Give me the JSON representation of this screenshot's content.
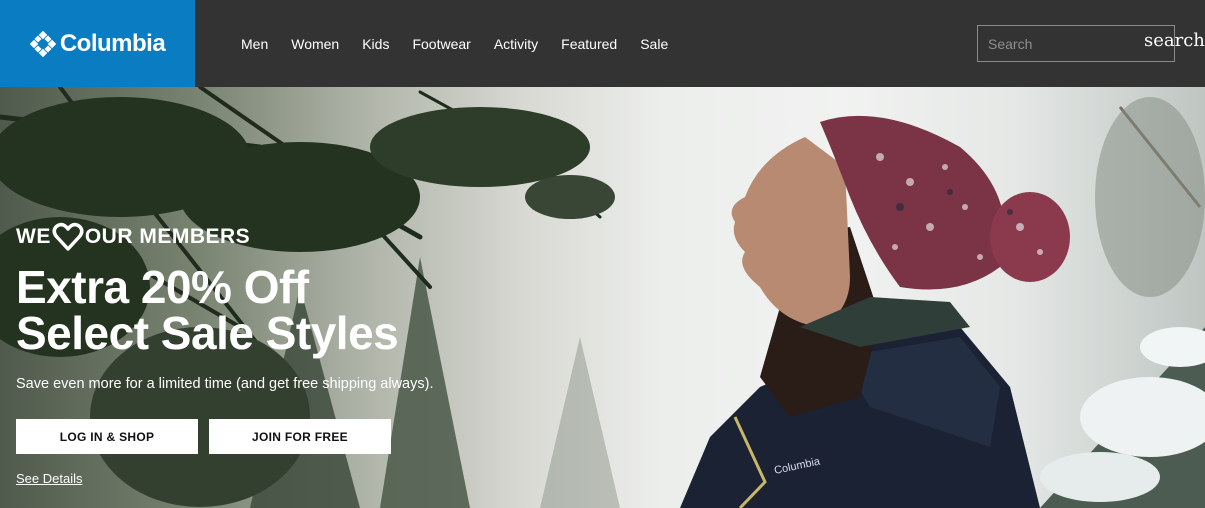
{
  "header": {
    "logo_text": "Columbia",
    "nav": [
      "Men",
      "Women",
      "Kids",
      "Footwear",
      "Activity",
      "Featured",
      "Sale"
    ],
    "search": {
      "placeholder": "Search",
      "button_label": "search"
    }
  },
  "hero": {
    "members_prefix": "WE",
    "members_suffix": "OUR MEMBERS",
    "headline_line1": "Extra 20% Off",
    "headline_line2": "Select Sale Styles",
    "subtext": "Save even more for a limited time (and get free shipping always).",
    "login_button": "LOG IN & SHOP",
    "join_button": "JOIN FOR FREE",
    "see_details": "See Details",
    "jacket_logo": "Columbia"
  },
  "colors": {
    "header_bg": "#333333",
    "logo_bg": "#0a7cc1",
    "button_bg": "#ffffff"
  }
}
